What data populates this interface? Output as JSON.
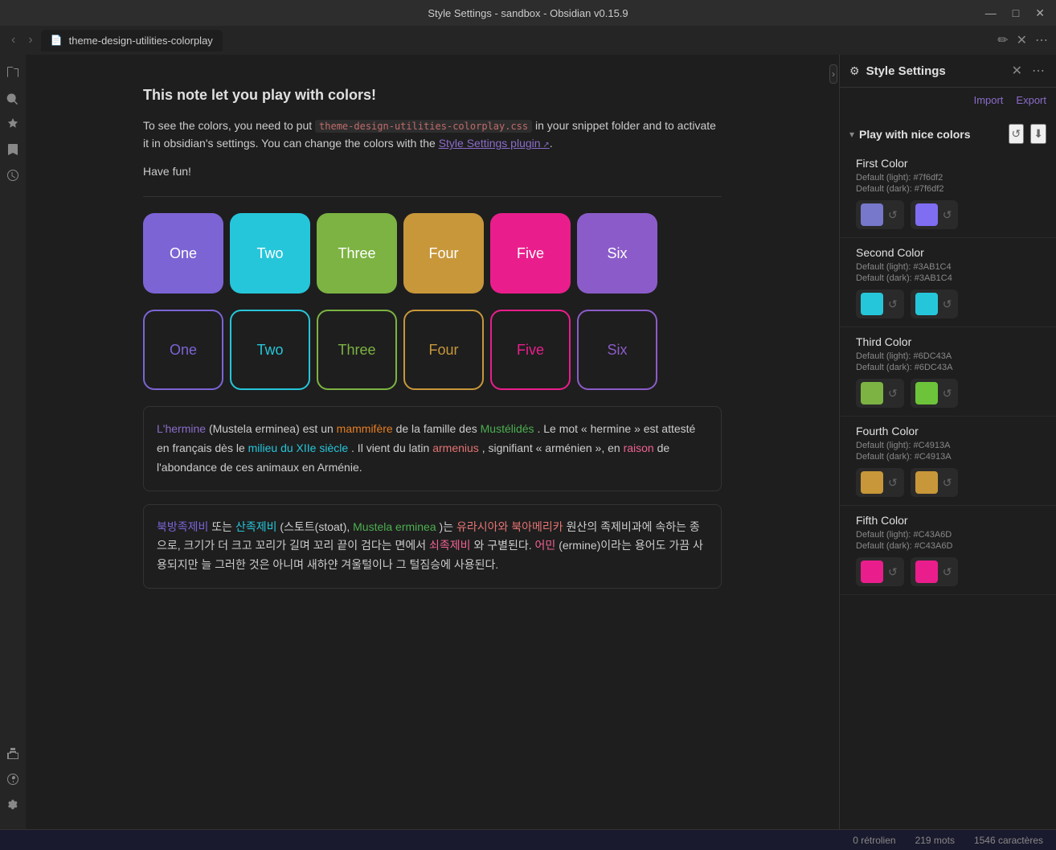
{
  "titlebar": {
    "title": "Style Settings - sandbox - Obsidian v0.15.9",
    "controls": [
      "—",
      "□",
      "✕"
    ]
  },
  "tabbar": {
    "nav_back": "‹",
    "nav_forward": "›",
    "tab_icon": "📄",
    "tab_label": "theme-design-utilities-colorplay",
    "edit_icon": "✏",
    "close_icon": "✕",
    "more_icon": "⋯"
  },
  "sidebar_left": {
    "icons": [
      "📁",
      "🔍",
      "⭐",
      "🔖",
      "⏱",
      "🔌",
      "⚙"
    ]
  },
  "editor": {
    "heading": "This note let you play with colors!",
    "para1_before": "To see the colors, you need to put ",
    "para1_code": "theme-design-utilities-colorplay.css",
    "para1_after": " in your snippet folder and to activate it in obsidian's settings. You can change the colors with the ",
    "para1_link": "Style Settings plugin",
    "para1_end": ".",
    "para2": "Have fun!",
    "color_boxes_filled": [
      {
        "label": "One",
        "color": "#7c64d5"
      },
      {
        "label": "Two",
        "color": "#26c6da"
      },
      {
        "label": "Three",
        "color": "#7cb342"
      },
      {
        "label": "Four",
        "color": "#c8973a"
      },
      {
        "label": "Five",
        "color": "#e91e8c"
      },
      {
        "label": "Six",
        "color": "#8b5cc9"
      }
    ],
    "color_boxes_outline": [
      {
        "label": "One",
        "color": "#7c64d5",
        "border_color": "#7c64d5"
      },
      {
        "label": "Two",
        "color": "#26c6da",
        "border_color": "#26c6da"
      },
      {
        "label": "Three",
        "color": "#7cb342",
        "border_color": "#7cb342"
      },
      {
        "label": "Four",
        "color": "#c8973a",
        "border_color": "#c8973a"
      },
      {
        "label": "Five",
        "color": "#e91e8c",
        "border_color": "#e91e8c"
      },
      {
        "label": "Six",
        "color": "#8b5cc9",
        "border_color": "#8b5cc9"
      }
    ],
    "text_block1": {
      "parts": [
        {
          "text": "L'hermine",
          "class": "color-hermine"
        },
        {
          "text": " (Mustela erminea) est un ",
          "class": ""
        },
        {
          "text": "mammifère",
          "class": "color-mammifere"
        },
        {
          "text": " de la famille des ",
          "class": ""
        },
        {
          "text": "Mustélidés",
          "class": "color-mustelides"
        },
        {
          "text": ". Le mot « hermine » est attesté en français dès le ",
          "class": ""
        },
        {
          "text": "milieu du XIIe siècle",
          "class": "color-milieu"
        },
        {
          "text": ". Il vient du latin ",
          "class": ""
        },
        {
          "text": "armenius",
          "class": "color-armenius"
        },
        {
          "text": ", signifiant « arménien », en ",
          "class": ""
        },
        {
          "text": "raison",
          "class": "color-raison"
        },
        {
          "text": " de l'abondance de ces animaux en Arménie.",
          "class": ""
        }
      ]
    },
    "text_block2_plain": "북방족제비 또는 산족제비(스토트(stoat), Mustela erminea)는 유라시아와 북아메리카 원산의 족제비과에 속하는 종으로, 크기가 더 크고 꼬리가 길며 꼬리 끝이 검다는 면에서 쇠족제비와 구별된다. 어민(ermine)이라는 용어도 가끔 사용되지만 늘 그러한 것은 아니며 새하얀 겨울털이나 그 털짐승에 사용된다."
  },
  "right_panel": {
    "title": "Style Settings",
    "import_label": "Import",
    "export_label": "Export",
    "section_title": "Play with nice colors",
    "colors": [
      {
        "name": "First Color",
        "default_light_label": "Default (light):",
        "default_light_value": "#7f6df2",
        "default_dark_label": "Default (dark):",
        "default_dark_value": "#7f6df2",
        "light_swatch_color": "#7777cc",
        "dark_swatch_color": "#7f6df2"
      },
      {
        "name": "Second Color",
        "default_light_label": "Default (light):",
        "default_light_value": "#3AB1C4",
        "default_dark_label": "Default (dark):",
        "default_dark_value": "#3AB1C4",
        "light_swatch_color": "#26c6da",
        "dark_swatch_color": "#26c6da"
      },
      {
        "name": "Third Color",
        "default_light_label": "Default (light):",
        "default_light_value": "#6DC43A",
        "default_dark_label": "Default (dark):",
        "default_dark_value": "#6DC43A",
        "light_swatch_color": "#7cb342",
        "dark_swatch_color": "#6DC43A"
      },
      {
        "name": "Fourth Color",
        "default_light_label": "Default (light):",
        "default_light_value": "#C4913A",
        "default_dark_label": "Default (dark):",
        "default_dark_value": "#C4913A",
        "light_swatch_color": "#c8973a",
        "dark_swatch_color": "#c8973a"
      },
      {
        "name": "Fifth Color",
        "default_light_label": "Default (light):",
        "default_light_value": "#C43A6D",
        "default_dark_label": "Default (dark):",
        "default_dark_value": "#C43A6D",
        "light_swatch_color": "#e91e8c",
        "dark_swatch_color": "#e91e8c"
      }
    ]
  },
  "status_bar": {
    "retrolien": "0 rétrolien",
    "mots": "219 mots",
    "caracteres": "1546 caractères"
  }
}
